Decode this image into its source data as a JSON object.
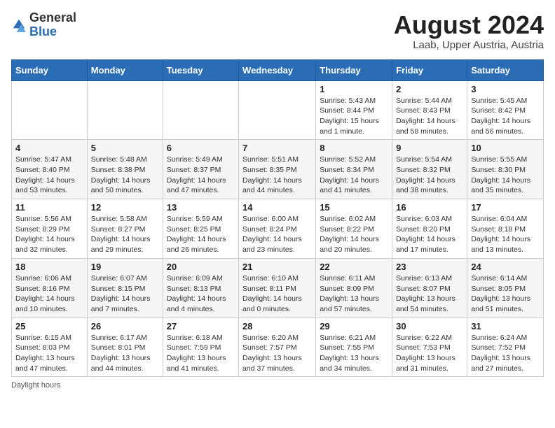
{
  "logo": {
    "text_general": "General",
    "text_blue": "Blue"
  },
  "title": {
    "month_year": "August 2024",
    "location": "Laab, Upper Austria, Austria"
  },
  "days_of_week": [
    "Sunday",
    "Monday",
    "Tuesday",
    "Wednesday",
    "Thursday",
    "Friday",
    "Saturday"
  ],
  "footer": {
    "note": "Daylight hours"
  },
  "weeks": [
    [
      {
        "day": "",
        "info": ""
      },
      {
        "day": "",
        "info": ""
      },
      {
        "day": "",
        "info": ""
      },
      {
        "day": "",
        "info": ""
      },
      {
        "day": "1",
        "info": "Sunrise: 5:43 AM\nSunset: 8:44 PM\nDaylight: 15 hours\nand 1 minute."
      },
      {
        "day": "2",
        "info": "Sunrise: 5:44 AM\nSunset: 8:43 PM\nDaylight: 14 hours\nand 58 minutes."
      },
      {
        "day": "3",
        "info": "Sunrise: 5:45 AM\nSunset: 8:42 PM\nDaylight: 14 hours\nand 56 minutes."
      }
    ],
    [
      {
        "day": "4",
        "info": "Sunrise: 5:47 AM\nSunset: 8:40 PM\nDaylight: 14 hours\nand 53 minutes."
      },
      {
        "day": "5",
        "info": "Sunrise: 5:48 AM\nSunset: 8:38 PM\nDaylight: 14 hours\nand 50 minutes."
      },
      {
        "day": "6",
        "info": "Sunrise: 5:49 AM\nSunset: 8:37 PM\nDaylight: 14 hours\nand 47 minutes."
      },
      {
        "day": "7",
        "info": "Sunrise: 5:51 AM\nSunset: 8:35 PM\nDaylight: 14 hours\nand 44 minutes."
      },
      {
        "day": "8",
        "info": "Sunrise: 5:52 AM\nSunset: 8:34 PM\nDaylight: 14 hours\nand 41 minutes."
      },
      {
        "day": "9",
        "info": "Sunrise: 5:54 AM\nSunset: 8:32 PM\nDaylight: 14 hours\nand 38 minutes."
      },
      {
        "day": "10",
        "info": "Sunrise: 5:55 AM\nSunset: 8:30 PM\nDaylight: 14 hours\nand 35 minutes."
      }
    ],
    [
      {
        "day": "11",
        "info": "Sunrise: 5:56 AM\nSunset: 8:29 PM\nDaylight: 14 hours\nand 32 minutes."
      },
      {
        "day": "12",
        "info": "Sunrise: 5:58 AM\nSunset: 8:27 PM\nDaylight: 14 hours\nand 29 minutes."
      },
      {
        "day": "13",
        "info": "Sunrise: 5:59 AM\nSunset: 8:25 PM\nDaylight: 14 hours\nand 26 minutes."
      },
      {
        "day": "14",
        "info": "Sunrise: 6:00 AM\nSunset: 8:24 PM\nDaylight: 14 hours\nand 23 minutes."
      },
      {
        "day": "15",
        "info": "Sunrise: 6:02 AM\nSunset: 8:22 PM\nDaylight: 14 hours\nand 20 minutes."
      },
      {
        "day": "16",
        "info": "Sunrise: 6:03 AM\nSunset: 8:20 PM\nDaylight: 14 hours\nand 17 minutes."
      },
      {
        "day": "17",
        "info": "Sunrise: 6:04 AM\nSunset: 8:18 PM\nDaylight: 14 hours\nand 13 minutes."
      }
    ],
    [
      {
        "day": "18",
        "info": "Sunrise: 6:06 AM\nSunset: 8:16 PM\nDaylight: 14 hours\nand 10 minutes."
      },
      {
        "day": "19",
        "info": "Sunrise: 6:07 AM\nSunset: 8:15 PM\nDaylight: 14 hours\nand 7 minutes."
      },
      {
        "day": "20",
        "info": "Sunrise: 6:09 AM\nSunset: 8:13 PM\nDaylight: 14 hours\nand 4 minutes."
      },
      {
        "day": "21",
        "info": "Sunrise: 6:10 AM\nSunset: 8:11 PM\nDaylight: 14 hours\nand 0 minutes."
      },
      {
        "day": "22",
        "info": "Sunrise: 6:11 AM\nSunset: 8:09 PM\nDaylight: 13 hours\nand 57 minutes."
      },
      {
        "day": "23",
        "info": "Sunrise: 6:13 AM\nSunset: 8:07 PM\nDaylight: 13 hours\nand 54 minutes."
      },
      {
        "day": "24",
        "info": "Sunrise: 6:14 AM\nSunset: 8:05 PM\nDaylight: 13 hours\nand 51 minutes."
      }
    ],
    [
      {
        "day": "25",
        "info": "Sunrise: 6:15 AM\nSunset: 8:03 PM\nDaylight: 13 hours\nand 47 minutes."
      },
      {
        "day": "26",
        "info": "Sunrise: 6:17 AM\nSunset: 8:01 PM\nDaylight: 13 hours\nand 44 minutes."
      },
      {
        "day": "27",
        "info": "Sunrise: 6:18 AM\nSunset: 7:59 PM\nDaylight: 13 hours\nand 41 minutes."
      },
      {
        "day": "28",
        "info": "Sunrise: 6:20 AM\nSunset: 7:57 PM\nDaylight: 13 hours\nand 37 minutes."
      },
      {
        "day": "29",
        "info": "Sunrise: 6:21 AM\nSunset: 7:55 PM\nDaylight: 13 hours\nand 34 minutes."
      },
      {
        "day": "30",
        "info": "Sunrise: 6:22 AM\nSunset: 7:53 PM\nDaylight: 13 hours\nand 31 minutes."
      },
      {
        "day": "31",
        "info": "Sunrise: 6:24 AM\nSunset: 7:52 PM\nDaylight: 13 hours\nand 27 minutes."
      }
    ]
  ]
}
